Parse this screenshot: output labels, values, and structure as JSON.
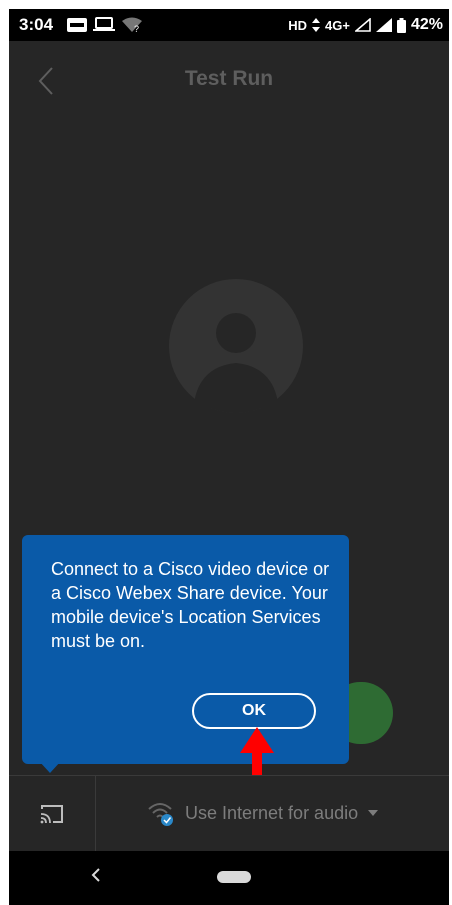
{
  "status_bar": {
    "time": "3:04",
    "network": "HD",
    "signal": "4G+",
    "battery": "42%"
  },
  "header": {
    "title": "Test Run",
    "back_icon": "chevron-left-icon"
  },
  "avatar": {
    "icon": "user-avatar-icon"
  },
  "tooltip": {
    "message": "Connect to a Cisco video device or a Cisco Webex Share device. Your mobile device's Location Services must be on.",
    "ok_label": "OK",
    "background_color": "#0a5aa8"
  },
  "annotation": {
    "arrow_color": "#ff0000"
  },
  "bottom_bar": {
    "cast_icon": "cast-icon",
    "audio_icon": "wifi-audio-icon",
    "audio_label": "Use Internet for audio",
    "dropdown_icon": "caret-down-icon"
  },
  "colors": {
    "background": "#262626",
    "join_button": "#2e6b33"
  }
}
